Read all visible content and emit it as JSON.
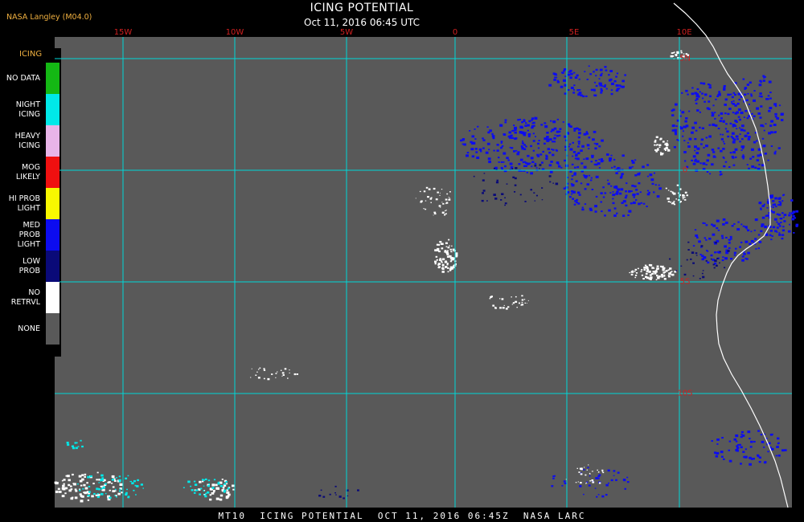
{
  "header": {
    "title": "ICING POTENTIAL",
    "datetime": "Oct 11, 2016 06:45 UTC",
    "credit": "NASA Langley (M04.0)"
  },
  "footer": {
    "text": "MT10  ICING POTENTIAL  OCT 11, 2016 06:45Z  NASA LARC"
  },
  "map": {
    "lon_labels": [
      "15W",
      "10W",
      "5W",
      "0",
      "5E",
      "10E"
    ],
    "lat_labels": [
      "5N",
      "0",
      "5S",
      "10S"
    ],
    "colors": {
      "background": "#000000",
      "map_fill": "#595959",
      "grid": "#00d8d8",
      "coastline": "#ffffff",
      "label": "#d02020"
    }
  },
  "legend": {
    "title": "ICING",
    "items": [
      {
        "label": "NO DATA",
        "color": "#14b814"
      },
      {
        "label": "NIGHT\nICING",
        "color": "#00e8e8"
      },
      {
        "label": "HEAVY\nICING",
        "color": "#e8b4e8"
      },
      {
        "label": "MOG\nLIKELY",
        "color": "#f01010"
      },
      {
        "label": "HI PROB\nLIGHT",
        "color": "#f8f800"
      },
      {
        "label": "MED PROB\nLIGHT",
        "color": "#0c0cf0"
      },
      {
        "label": "LOW\nPROB",
        "color": "#0a0a78"
      },
      {
        "label": "NO\nRETRVL",
        "color": "#ffffff"
      },
      {
        "label": "NONE",
        "color": "#595959"
      }
    ]
  }
}
